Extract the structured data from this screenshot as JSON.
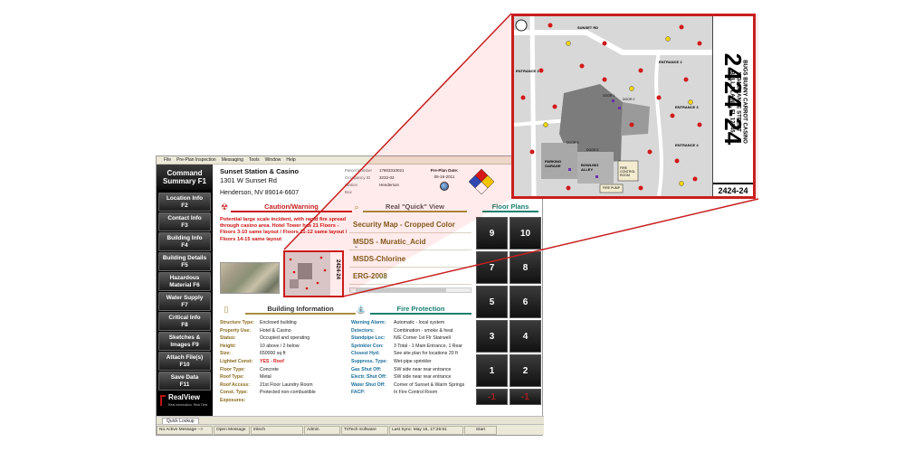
{
  "menu": [
    "File",
    "Pre-Plan Inspection",
    "Messaging",
    "Tools",
    "Window",
    "Help"
  ],
  "sidebar": {
    "command_summary": [
      "Command",
      "Summary F1"
    ],
    "buttons": [
      [
        "Location Info",
        "F2"
      ],
      [
        "Contact Info",
        "F3"
      ],
      [
        "Building Info",
        "F4"
      ],
      [
        "Building Details",
        "F5"
      ],
      [
        "Hazardous",
        "Material    F6"
      ],
      [
        "Water Supply",
        "F7"
      ],
      [
        "Critical Info",
        "F8"
      ],
      [
        "Sketches &",
        "Images    F9"
      ],
      [
        "Attach File(s)",
        "F10"
      ],
      [
        "Save Data",
        "F11"
      ]
    ],
    "logo_text": "RealView",
    "logo_sub": "Real Information. Real Time."
  },
  "header": {
    "name": "Sunset Station & Casino",
    "address": "1301 W Sunset Rd",
    "city": "Henderson, NV 89014-6607",
    "fields": [
      {
        "k": "Parcel Number",
        "v": "17803310021"
      },
      {
        "k": "Occupancy ID",
        "v": "3232-03"
      },
      {
        "k": "Station",
        "v": "Henderson"
      },
      {
        "k": "Box",
        "v": ""
      }
    ],
    "preplan_label": "Pre-Plan Date:",
    "preplan_date": "05-16-2011"
  },
  "caution": {
    "title": "Caution/Warning",
    "text": "Potential large scale incident, with rapid fire spread through casino area. Hotel Tower has 21 Floors - Floors 3-10 same layout / Floors 11-12 same layout / Floors 14-15 same layout",
    "scroll_glyph": "⌄"
  },
  "quick_view": {
    "title": "Real \"Quick\" View",
    "items": [
      "Security Map - Cropped Color",
      "MSDS - Muratic_Acid",
      "MSDS-Chlorine",
      "ERG-2008"
    ]
  },
  "floor_plans": {
    "title": "Floor Plans",
    "buttons": [
      "9",
      "10",
      "7",
      "8",
      "5",
      "6",
      "3",
      "4",
      "1",
      "2",
      "-1",
      "-1"
    ]
  },
  "building_info": {
    "title": "Building Information",
    "rows": [
      {
        "k": "Structure Type:",
        "v": "Enclosed building"
      },
      {
        "k": "Property Use:",
        "v": "Hotel & Casino"
      },
      {
        "k": "Status:",
        "v": "Occupied and operating"
      },
      {
        "k": "Height:",
        "v": "10 above / 2 below"
      },
      {
        "k": "Size:",
        "v": "650000 sq ft"
      },
      {
        "k": "Lightwt Const:",
        "v": "YES - Roof"
      },
      {
        "k": "Floor Type:",
        "v": "Concrete"
      },
      {
        "k": "Roof Type:",
        "v": "Metal"
      },
      {
        "k": "Roof Access:",
        "v": "21st Floor Laundry Room"
      },
      {
        "k": "Const. Type:",
        "v": "Protected non-combustible"
      },
      {
        "k": "Exposures:",
        "v": ""
      }
    ]
  },
  "fire_protection": {
    "title": "Fire Protection",
    "rows": [
      {
        "k": "Warning Alarm:",
        "v": "Automatic - local system"
      },
      {
        "k": "Detectors:",
        "v": "Combination - smoke & heat"
      },
      {
        "k": "Standpipe Loc:",
        "v": "N/E Corner 1st Flr Stairwell"
      },
      {
        "k": "Sprinkler Con:",
        "v": "3 Total - 1 Main Entrance, 1 Rear"
      },
      {
        "k": "Closest Hyd:",
        "v": "See site plan for locations 20 ft"
      },
      {
        "k": "Suppress. Type:",
        "v": "Wet-pipe sprinkler"
      },
      {
        "k": "Gas Shut Off:",
        "v": "SW side near rear entrance"
      },
      {
        "k": "Electr. Shut Off:",
        "v": "SW side near rear entrance"
      },
      {
        "k": "Water Shut Off:",
        "v": "Corner of Sunset & Warm Springs"
      },
      {
        "k": "FACP:",
        "v": "In Fire Control Room"
      }
    ]
  },
  "bottom_tab": "Quick Lookup",
  "status": [
    "No Active Message -->",
    "Open Message",
    "tritech",
    "Admin",
    "TriTech Software",
    "Last Sync: May 16, 17:25:51",
    "Start"
  ],
  "zoom_map": {
    "big_number": "2424-24",
    "name_lines": [
      "BUGS BUNNY CARROT CASINO",
      "1234 ORANGE STREET",
      "BELL PLAINS, FL 12345"
    ],
    "small_number": "2424-24",
    "labels": [
      "SUNSET RD",
      "ENTRANCE 1",
      "ENTRANCE 2",
      "ENTRANCE 3",
      "ENTRANCE 4",
      "DOOR 1",
      "DOOR 2",
      "DOOR 3",
      "DOOR 5",
      "PARKING GARAGE",
      "BOWLING ALLEY",
      "FIRE CONTROL ROOM",
      "FIRE PUMP"
    ]
  },
  "colors": {
    "accent_red": "#c81e1e",
    "gold": "#a78f40",
    "teal": "#1a8070"
  }
}
